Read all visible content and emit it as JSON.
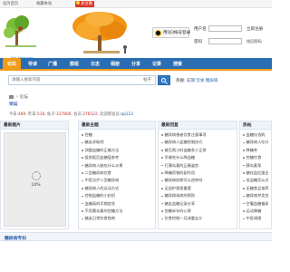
{
  "topbar": {
    "links": [
      "设为首页",
      "收藏本站"
    ],
    "weibo_label": "关注微博"
  },
  "logo": {
    "name": "糖",
    "url": "bbs.tnhfr.com"
  },
  "login": {
    "qq_label": "用QQ帐号登录",
    "username_label": "用户名",
    "password_label": "密码",
    "register_label": "立即注册",
    "forgot_label": "找回密码"
  },
  "nav": {
    "items": [
      "论坛",
      "导读",
      "广播",
      "群组",
      "日志",
      "相册",
      "分享",
      "记录",
      "搜索"
    ]
  },
  "search": {
    "placeholder": "请输入搜索内容",
    "scope": "帖子",
    "hot_label": "热搜:",
    "hot_items": [
      "前期",
      "饮食",
      "糖尿病"
    ]
  },
  "breadcrumb": {
    "separator": "›",
    "current": "论坛"
  },
  "forum": {
    "name": "论坛"
  },
  "stats": {
    "today_label": "今日:",
    "today": "489",
    "yesterday_label": "昨日:",
    "yesterday": "538",
    "posts_label": "帖子:",
    "posts": "337806",
    "members_label": "会员:",
    "members": "276522",
    "newest_label": "欢迎新会员:",
    "newest": "qq123"
  },
  "panels": {
    "images": {
      "title": "最新图片",
      "progress": "10%"
    },
    "latest": {
      "title": "最新主题",
      "items": [
        "控糖",
        "糖友求助吧",
        "测量血糖的正确方法",
        "饭前饭后血糖值参考",
        "糖尿病人能吃什么水果",
        "二型糖尿病饮食",
        "中医治疗二型糖尿病",
        "糖尿病人的运动方式",
        "控制血糖的小妙招",
        "血糖高的早期症状",
        "不用胰岛素的控糖方法",
        "糖友日常饮食指南"
      ]
    },
    "replies": {
      "title": "最新回复",
      "items": [
        "糖尿病患者饮食注意事项",
        "糖尿病人血糖控制技巧",
        "餐后两小时血糖多少正常",
        "早餐吃什么降血糖",
        "打胰岛素的正确姿势",
        "降糖药物的副作用",
        "糖尿病前期可以逆转吗",
        "足部护理很重要",
        "糖尿病肾病的预防",
        "糖友血糖记录分享",
        "控糖半年的心得",
        "饮食控制一月减重五斤"
      ]
    },
    "hot": {
      "title": "热帖",
      "items": [
        "血糖仪选购",
        "糖尿病人吃什么",
        "降糖茶",
        "控糖饮食",
        "胰岛素泵",
        "糖化血红蛋白",
        "低血糖怎么办",
        "无糖食品推荐",
        "糖尿病并发症",
        "空腹血糖偏高",
        "运动降糖",
        "中医调理"
      ]
    }
  },
  "bottom": {
    "title": "糖尿病专科"
  },
  "colors": {
    "nav_blue": "#2a6db3",
    "nav_active": "#f19b18",
    "link_blue": "#2a5caa",
    "weibo_red": "#d83a2a"
  }
}
